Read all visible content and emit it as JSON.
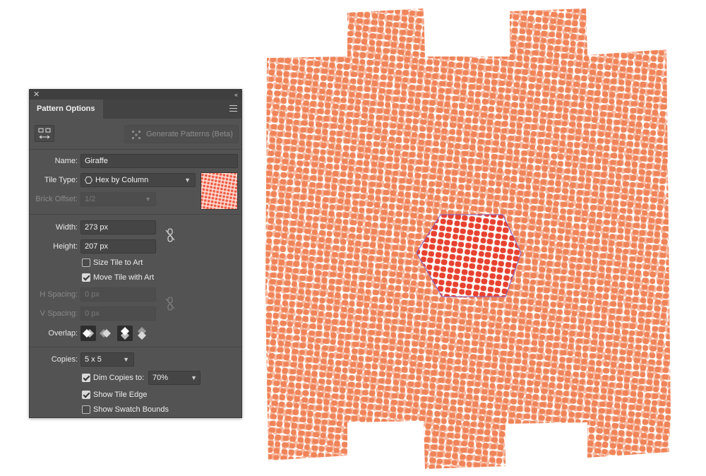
{
  "panel": {
    "title": "Pattern Options",
    "close_glyph": "✕",
    "collapse_glyph": "‹‹",
    "generate_label": "Generate Patterns (Beta)",
    "name_label": "Name:",
    "name_value": "Giraffe",
    "tile_type_label": "Tile Type:",
    "tile_type_value": "Hex by Column",
    "brick_offset_label": "Brick Offset:",
    "brick_offset_value": "1/2",
    "width_label": "Width:",
    "width_value": "273 px",
    "height_label": "Height:",
    "height_value": "207 px",
    "size_tile_to_art_label": "Size Tile to Art",
    "size_tile_to_art_checked": false,
    "move_tile_with_art_label": "Move Tile with Art",
    "move_tile_with_art_checked": true,
    "h_spacing_label": "H Spacing:",
    "h_spacing_value": "0 px",
    "v_spacing_label": "V Spacing:",
    "v_spacing_value": "0 px",
    "overlap_label": "Overlap:",
    "copies_label": "Copies:",
    "copies_value": "5 x 5",
    "dim_copies_label": "Dim Copies to:",
    "dim_copies_checked": true,
    "dim_copies_value": "70%",
    "show_tile_edge_label": "Show Tile Edge",
    "show_tile_edge_checked": true,
    "show_swatch_bounds_label": "Show Swatch Bounds",
    "show_swatch_bounds_checked": false
  },
  "colors": {
    "pattern_copy": "#f08459",
    "pattern_tile": "#e8412f",
    "tile_edge": "#7b5cc8",
    "panel_bg": "#535353"
  },
  "icons": {
    "tile_tool": "tile-edit-tool-icon",
    "generate": "generate-patterns-icon",
    "hex_column": "hexagon-icon",
    "link_size": "link-icon",
    "link_spacing": "link-icon",
    "menu": "hamburger-menu-icon"
  }
}
